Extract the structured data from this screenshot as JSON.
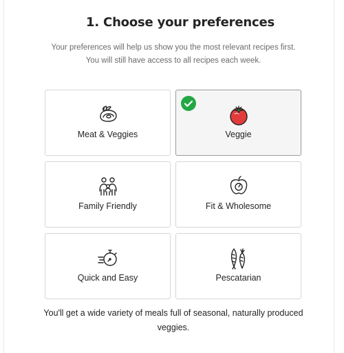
{
  "header": {
    "title": "1. Choose your preferences",
    "subtitle": "Your preferences will help us show you the most relevant recipes first. You will still have access to all recipes each week."
  },
  "preferences": [
    {
      "label": "Meat & Veggies",
      "icon": "meat-veggies-icon",
      "selected": false
    },
    {
      "label": "Veggie",
      "icon": "tomato-icon",
      "selected": true
    },
    {
      "label": "Family Friendly",
      "icon": "family-icon",
      "selected": false
    },
    {
      "label": "Fit & Wholesome",
      "icon": "apple-scale-icon",
      "selected": false
    },
    {
      "label": "Quick and Easy",
      "icon": "stopwatch-icon",
      "selected": false
    },
    {
      "label": "Pescatarian",
      "icon": "fish-carrot-icon",
      "selected": false
    }
  ],
  "selection_description": "You'll get a wide variety of meals full of seasonal, naturally produced veggies.",
  "colors": {
    "check_badge": "#23a745",
    "tomato": "#e23b3b",
    "selected_card_bg": "#f5f5f5"
  }
}
